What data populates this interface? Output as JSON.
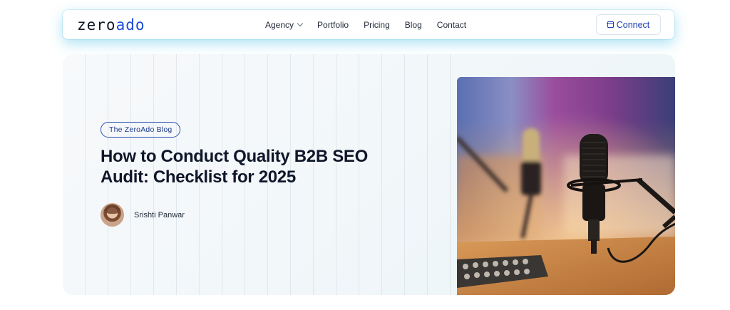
{
  "header": {
    "logo": {
      "part1": "zero",
      "part2": "ado"
    },
    "nav": [
      {
        "label": "Agency",
        "has_dropdown": true
      },
      {
        "label": "Portfolio"
      },
      {
        "label": "Pricing"
      },
      {
        "label": "Blog"
      },
      {
        "label": "Contact"
      }
    ],
    "cta": {
      "label": "Connect",
      "icon": "calendar-icon"
    }
  },
  "hero": {
    "tag": "The ZeroAdo Blog",
    "title": "How to Conduct Quality B2B SEO Audit: Checklist for 2025",
    "author": {
      "name": "Srishti Panwar",
      "avatar": "author-avatar"
    },
    "image": "podcast-microphones-photo"
  },
  "colors": {
    "brand_blue": "#1d4ed8",
    "text_dark": "#0f172a",
    "glow": "#46bee6"
  }
}
